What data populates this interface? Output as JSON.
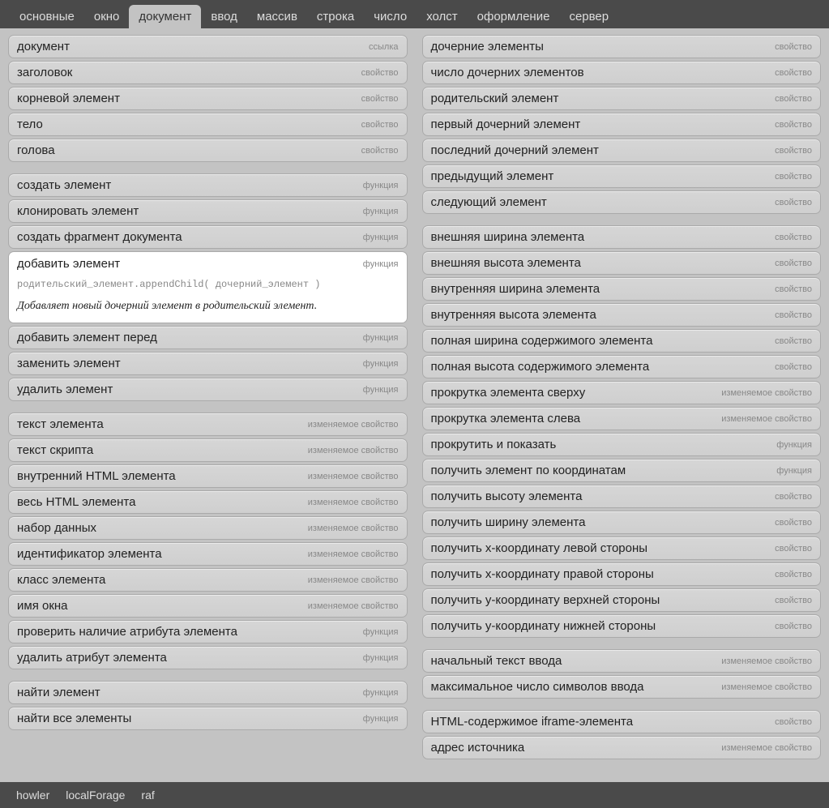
{
  "nav": {
    "tabs": [
      "основные",
      "окно",
      "документ",
      "ввод",
      "массив",
      "строка",
      "число",
      "холст",
      "оформление",
      "сервер"
    ],
    "active": 2
  },
  "badges": {
    "link": "ссылка",
    "prop": "свойство",
    "func": "функция",
    "mutprop": "изменяемое свойство"
  },
  "left": [
    [
      {
        "l": "документ",
        "b": "link"
      },
      {
        "l": "заголовок",
        "b": "prop"
      },
      {
        "l": "корневой элемент",
        "b": "prop"
      },
      {
        "l": "тело",
        "b": "prop"
      },
      {
        "l": "голова",
        "b": "prop"
      }
    ],
    [
      {
        "l": "создать элемент",
        "b": "func"
      },
      {
        "l": "клонировать элемент",
        "b": "func"
      },
      {
        "l": "создать фрагмент документа",
        "b": "func"
      },
      {
        "l": "добавить элемент",
        "b": "func",
        "expanded": true,
        "sig": "родительский_элемент.appendChild( дочерний_элемент )",
        "desc": "Добавляет новый дочерний элемент в родительский элемент."
      },
      {
        "l": "добавить элемент перед",
        "b": "func"
      },
      {
        "l": "заменить элемент",
        "b": "func"
      },
      {
        "l": "удалить элемент",
        "b": "func"
      }
    ],
    [
      {
        "l": "текст элемента",
        "b": "mutprop"
      },
      {
        "l": "текст скрипта",
        "b": "mutprop"
      },
      {
        "l": "внутренний HTML элемента",
        "b": "mutprop"
      },
      {
        "l": "весь HTML элемента",
        "b": "mutprop"
      },
      {
        "l": "набор данных",
        "b": "mutprop"
      },
      {
        "l": "идентификатор элемента",
        "b": "mutprop"
      },
      {
        "l": "класс элемента",
        "b": "mutprop"
      },
      {
        "l": "имя окна",
        "b": "mutprop"
      },
      {
        "l": "проверить наличие атрибута элемента",
        "b": "func"
      },
      {
        "l": "удалить атрибут элемента",
        "b": "func"
      }
    ],
    [
      {
        "l": "найти элемент",
        "b": "func"
      },
      {
        "l": "найти все элементы",
        "b": "func"
      }
    ]
  ],
  "right": [
    [
      {
        "l": "дочерние элементы",
        "b": "prop"
      },
      {
        "l": "число дочерних элементов",
        "b": "prop"
      },
      {
        "l": "родительский элемент",
        "b": "prop"
      },
      {
        "l": "первый дочерний элемент",
        "b": "prop"
      },
      {
        "l": "последний дочерний элемент",
        "b": "prop"
      },
      {
        "l": "предыдущий элемент",
        "b": "prop"
      },
      {
        "l": "следующий элемент",
        "b": "prop"
      }
    ],
    [
      {
        "l": "внешняя ширина элемента",
        "b": "prop"
      },
      {
        "l": "внешняя высота элемента",
        "b": "prop"
      },
      {
        "l": "внутренняя ширина элемента",
        "b": "prop"
      },
      {
        "l": "внутренняя высота элемента",
        "b": "prop"
      },
      {
        "l": "полная ширина содержимого элемента",
        "b": "prop"
      },
      {
        "l": "полная высота содержимого элемента",
        "b": "prop"
      },
      {
        "l": "прокрутка элемента сверху",
        "b": "mutprop"
      },
      {
        "l": "прокрутка элемента слева",
        "b": "mutprop"
      },
      {
        "l": "прокрутить и показать",
        "b": "func"
      },
      {
        "l": "получить элемент по координатам",
        "b": "func"
      },
      {
        "l": "получить высоту элемента",
        "b": "prop"
      },
      {
        "l": "получить ширину элемента",
        "b": "prop"
      },
      {
        "l": "получить x-координату левой стороны",
        "b": "prop"
      },
      {
        "l": "получить x-координату правой стороны",
        "b": "prop"
      },
      {
        "l": "получить y-координату верхней стороны",
        "b": "prop"
      },
      {
        "l": "получить y-координату нижней стороны",
        "b": "prop"
      }
    ],
    [
      {
        "l": "начальный текст ввода",
        "b": "mutprop"
      },
      {
        "l": "максимальное число символов ввода",
        "b": "mutprop"
      }
    ],
    [
      {
        "l": "HTML-содержимое iframe-элемента",
        "b": "prop"
      },
      {
        "l": "адрес источника",
        "b": "mutprop"
      }
    ]
  ],
  "footer": [
    "howler",
    "localForage",
    "raf"
  ]
}
